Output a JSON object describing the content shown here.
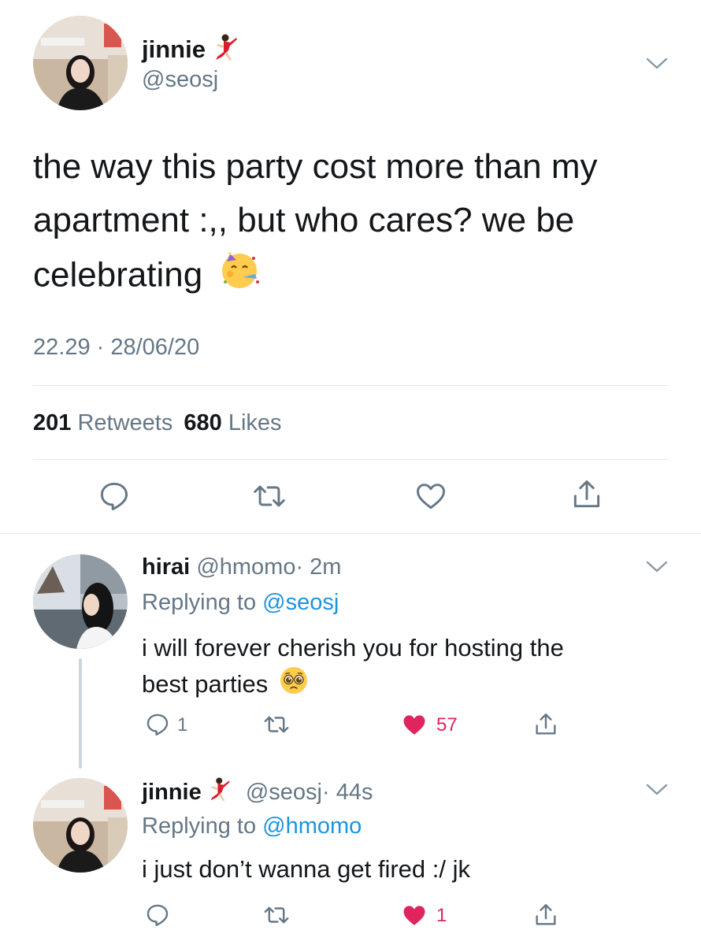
{
  "main_tweet": {
    "display_name": "jinnie",
    "handle": "@seosj",
    "name_emoji": "dancer-emoji",
    "text_line1": "the way this party cost more than my",
    "text_line2": "apartment :,, but who cares? we be",
    "text_line3": "celebrating",
    "text_emoji": "partying-face-emoji",
    "timestamp": "22.29 · 28/06/20",
    "retweets_count": "201",
    "retweets_label": "Retweets",
    "likes_count": "680",
    "likes_label": "Likes"
  },
  "replies": [
    {
      "display_name": "hirai",
      "handle": "@hmomo",
      "age": "· 2m",
      "replying_prefix": "Replying to",
      "replying_to": "@seosj",
      "text_line1": "i will forever cherish you for hosting the",
      "text_line2": "best parties",
      "text_emoji": "pleading-face-emoji",
      "reply_count": "1",
      "like_count": "57",
      "liked": true
    },
    {
      "display_name": "jinnie",
      "handle": "@seosj",
      "age": "· 44s",
      "name_emoji": "dancer-emoji",
      "replying_prefix": "Replying to",
      "replying_to": "@hmomo",
      "text_line1": "i just don’t wanna get fired :/ jk",
      "reply_count": "",
      "like_count": "1",
      "liked": true
    }
  ],
  "colors": {
    "text": "#14171a",
    "secondary": "#657786",
    "link": "#1b95e0",
    "like": "#e0245e",
    "divider": "#e1e8ed"
  }
}
